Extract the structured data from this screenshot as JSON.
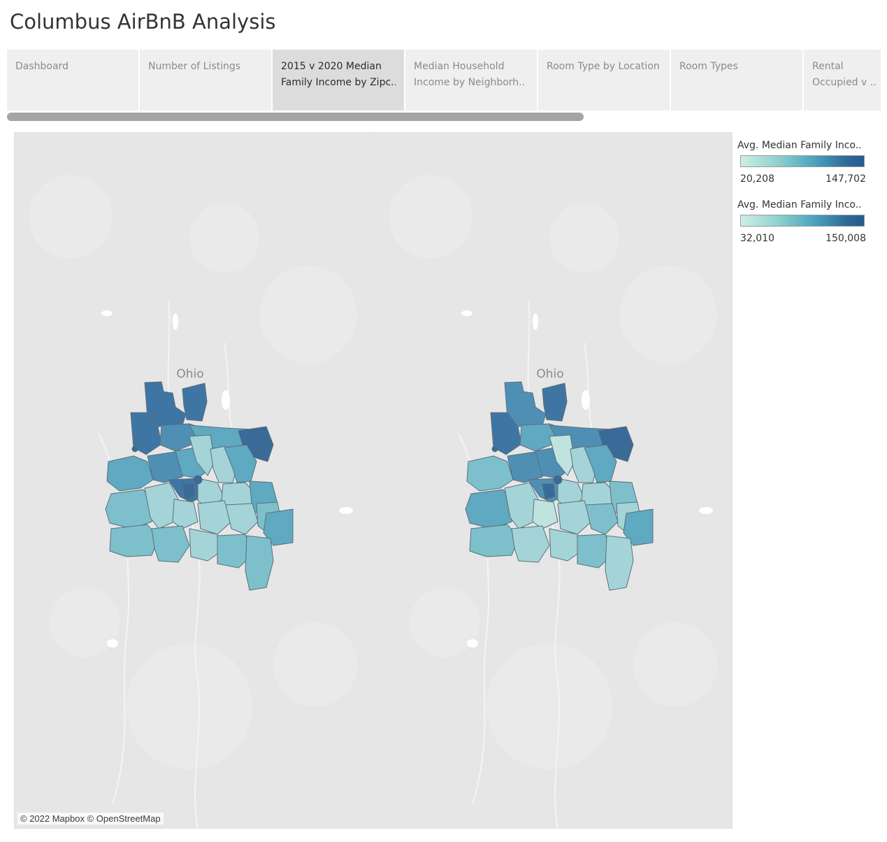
{
  "page": {
    "title": "Columbus AirBnB Analysis"
  },
  "tabs": [
    {
      "lines": [
        "Dashboard"
      ],
      "active": false
    },
    {
      "lines": [
        "Number of Listings"
      ],
      "active": false
    },
    {
      "lines": [
        "2015 v 2020 Median",
        "Family Income by Zipc.."
      ],
      "active": true
    },
    {
      "lines": [
        "Median Household",
        "Income by Neighborh.."
      ],
      "active": false
    },
    {
      "lines": [
        "Room Type by Location"
      ],
      "active": false
    },
    {
      "lines": [
        "Room Types"
      ],
      "active": false
    },
    {
      "lines": [
        "Rental",
        "Occupied v .."
      ],
      "active": false
    }
  ],
  "maps": {
    "state_label": "Ohio",
    "attribution": "© 2022 Mapbox © OpenStreetMap",
    "left_colors": [
      "#bfe3df",
      "#a5d4d8",
      "#7dc0cc",
      "#5fa9c1",
      "#4f8fb4",
      "#3f75a3",
      "#3a6a98"
    ],
    "right_colors": [
      "#bfe3df",
      "#a5d4d8",
      "#7dc0cc",
      "#5fa9c1",
      "#4f8fb4",
      "#3f75a3",
      "#3a6a98"
    ]
  },
  "legends": [
    {
      "title": "Avg. Median Family Inco..",
      "min": "20,208",
      "max": "147,702"
    },
    {
      "title": "Avg. Median Family Inco..",
      "min": "32,010",
      "max": "150,008"
    }
  ]
}
